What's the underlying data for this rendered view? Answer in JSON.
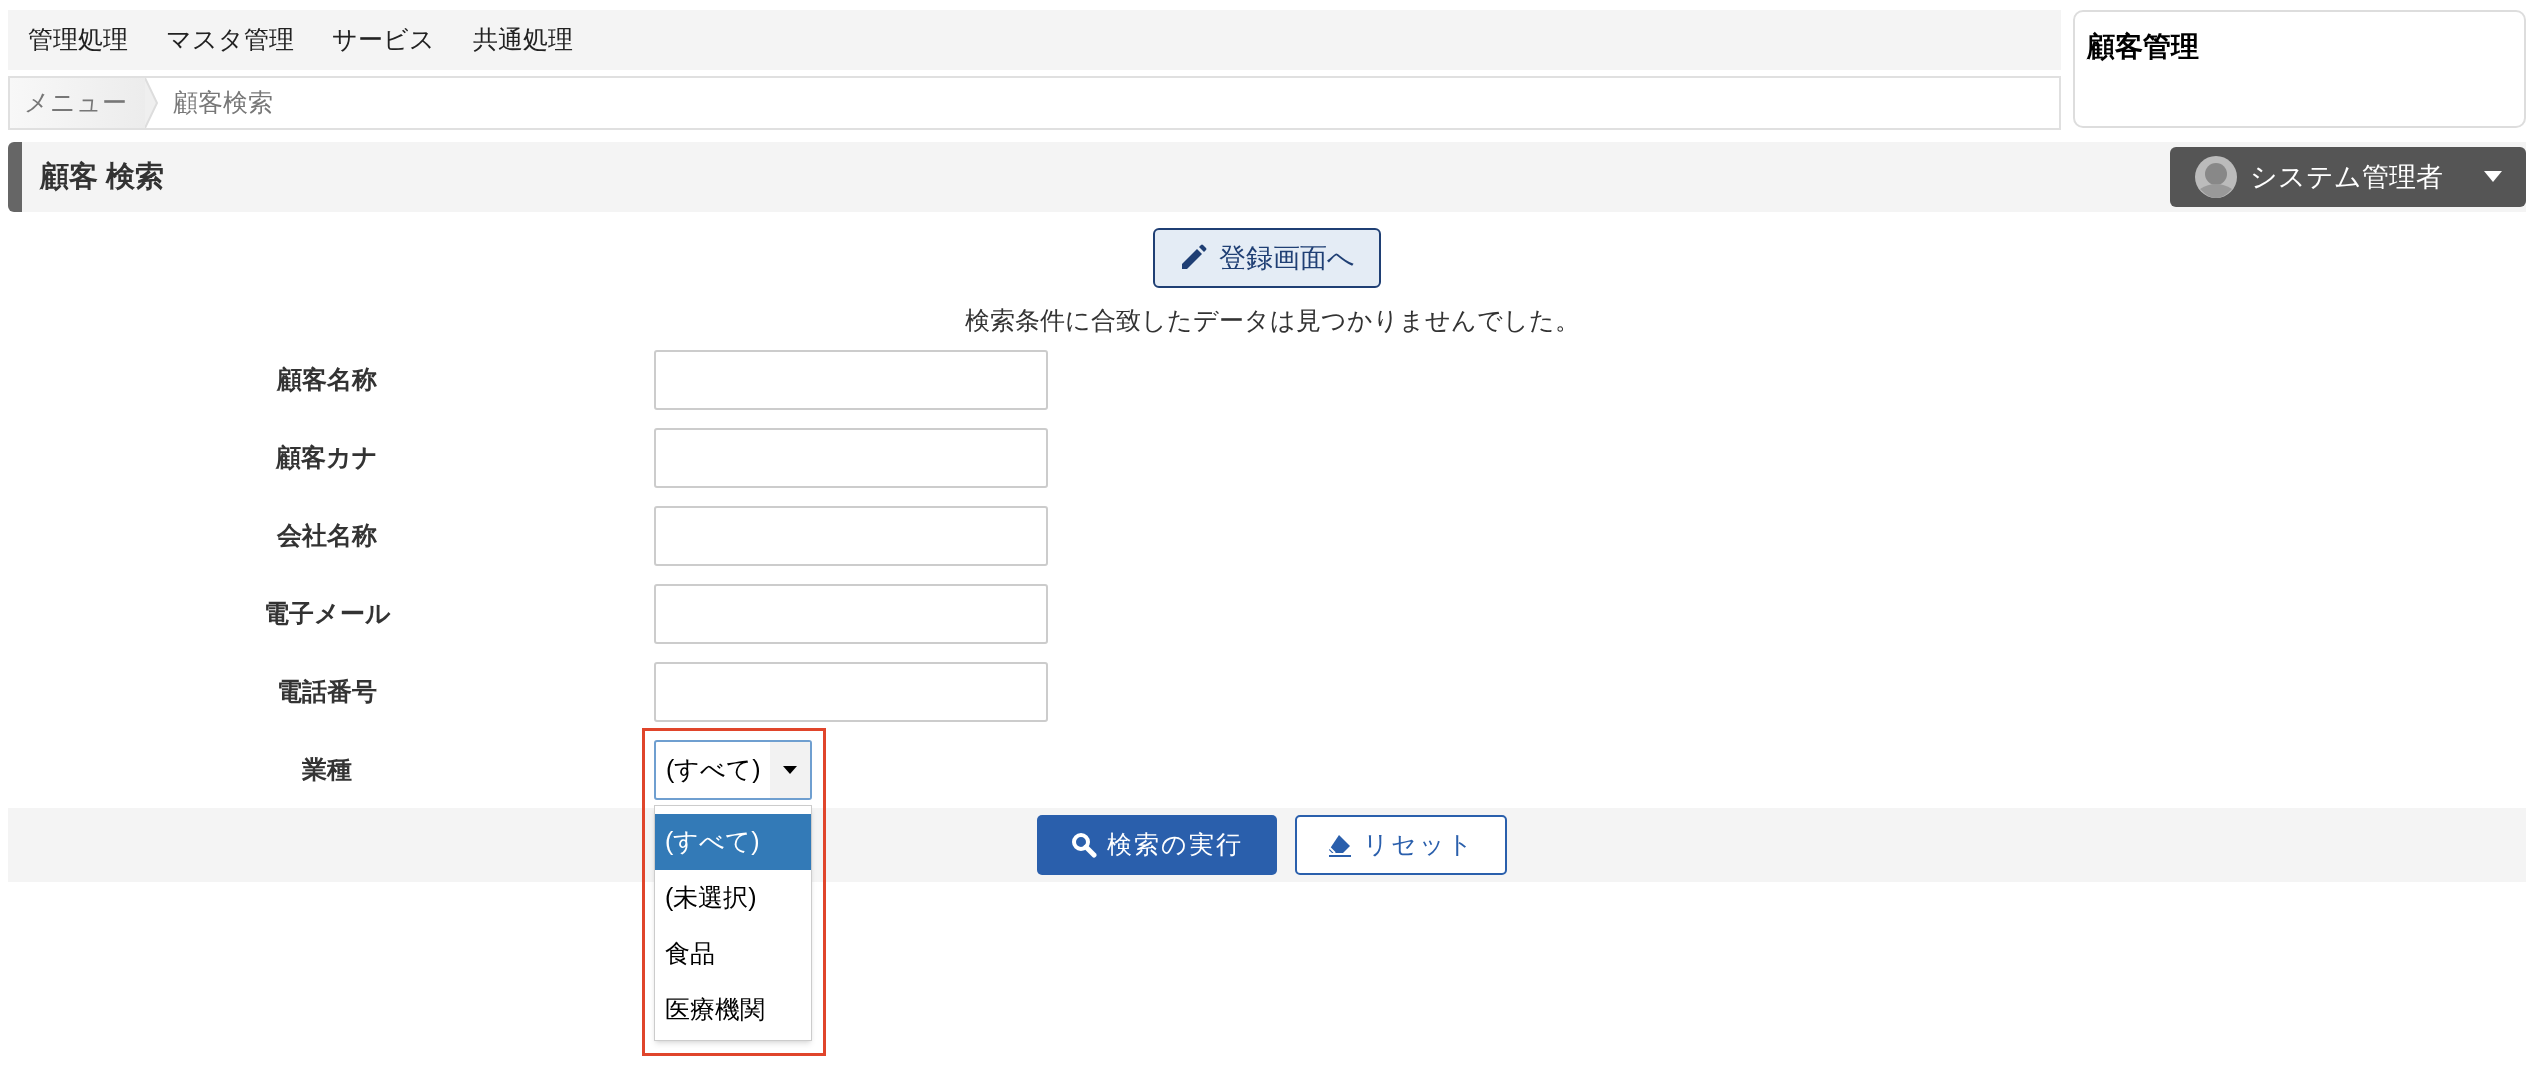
{
  "menu_bar": {
    "items": [
      "管理処理",
      "マスタ管理",
      "サービス",
      "共通処理"
    ]
  },
  "breadcrumb": [
    "メニュー",
    "顧客検索"
  ],
  "app_panel": {
    "title": "顧客管理"
  },
  "page_header": {
    "title": "顧客 検索"
  },
  "user_menu": {
    "label": "システム管理者"
  },
  "register_button": {
    "label": "登録画面へ"
  },
  "message": "検索条件に合致したデータは見つかりませんでした。",
  "form": {
    "fields": [
      {
        "label": "顧客名称",
        "kind": "text"
      },
      {
        "label": "顧客カナ",
        "kind": "text"
      },
      {
        "label": "会社名称",
        "kind": "text"
      },
      {
        "label": "電子メール",
        "kind": "text"
      },
      {
        "label": "電話番号",
        "kind": "text"
      },
      {
        "label": "業種",
        "kind": "select",
        "value": "(すべて)",
        "expanded": true,
        "options": [
          {
            "label": "(すべて)",
            "selected": true
          },
          {
            "label": "(未選択)",
            "selected": false
          },
          {
            "label": "食品",
            "selected": false
          },
          {
            "label": "医療機関",
            "selected": false
          }
        ]
      }
    ]
  },
  "actions": [
    {
      "label": "検索の実行",
      "kind": "primary"
    },
    {
      "label": "リセット",
      "kind": "secondary"
    }
  ]
}
